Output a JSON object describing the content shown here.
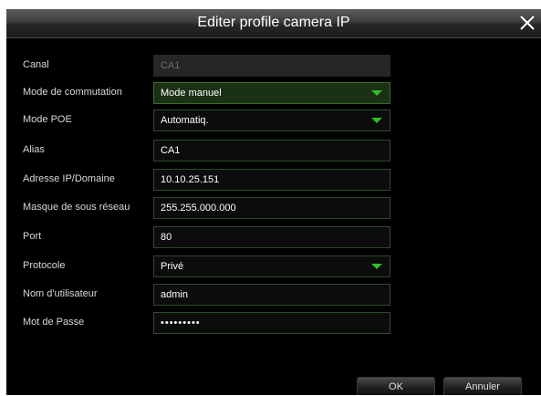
{
  "dialog": {
    "title": "Editer profile camera IP",
    "close_icon": "close-icon"
  },
  "form": {
    "canal": {
      "label": "Canal",
      "value": "CA1"
    },
    "mode_commutation": {
      "label": "Mode de commutation",
      "value": "Mode manuel"
    },
    "mode_poe": {
      "label": "Mode POE",
      "value": "Automatiq."
    },
    "alias": {
      "label": "Alias",
      "value": "CA1"
    },
    "adresse_ip": {
      "label": "Adresse IP/Domaine",
      "value": "10.10.25.151"
    },
    "masque": {
      "label": "Masque de sous réseau",
      "value": "255.255.000.000"
    },
    "port": {
      "label": "Port",
      "value": "80"
    },
    "protocole": {
      "label": "Protocole",
      "value": "Privé"
    },
    "utilisateur": {
      "label": "Nom d'utilisateur",
      "value": "admin"
    },
    "mot_de_passe": {
      "label": "Mot de Passe",
      "value": "•••••••••"
    }
  },
  "buttons": {
    "ok": "OK",
    "cancel": "Annuler"
  },
  "colors": {
    "accent": "#2fbf2a",
    "background": "#000000"
  }
}
